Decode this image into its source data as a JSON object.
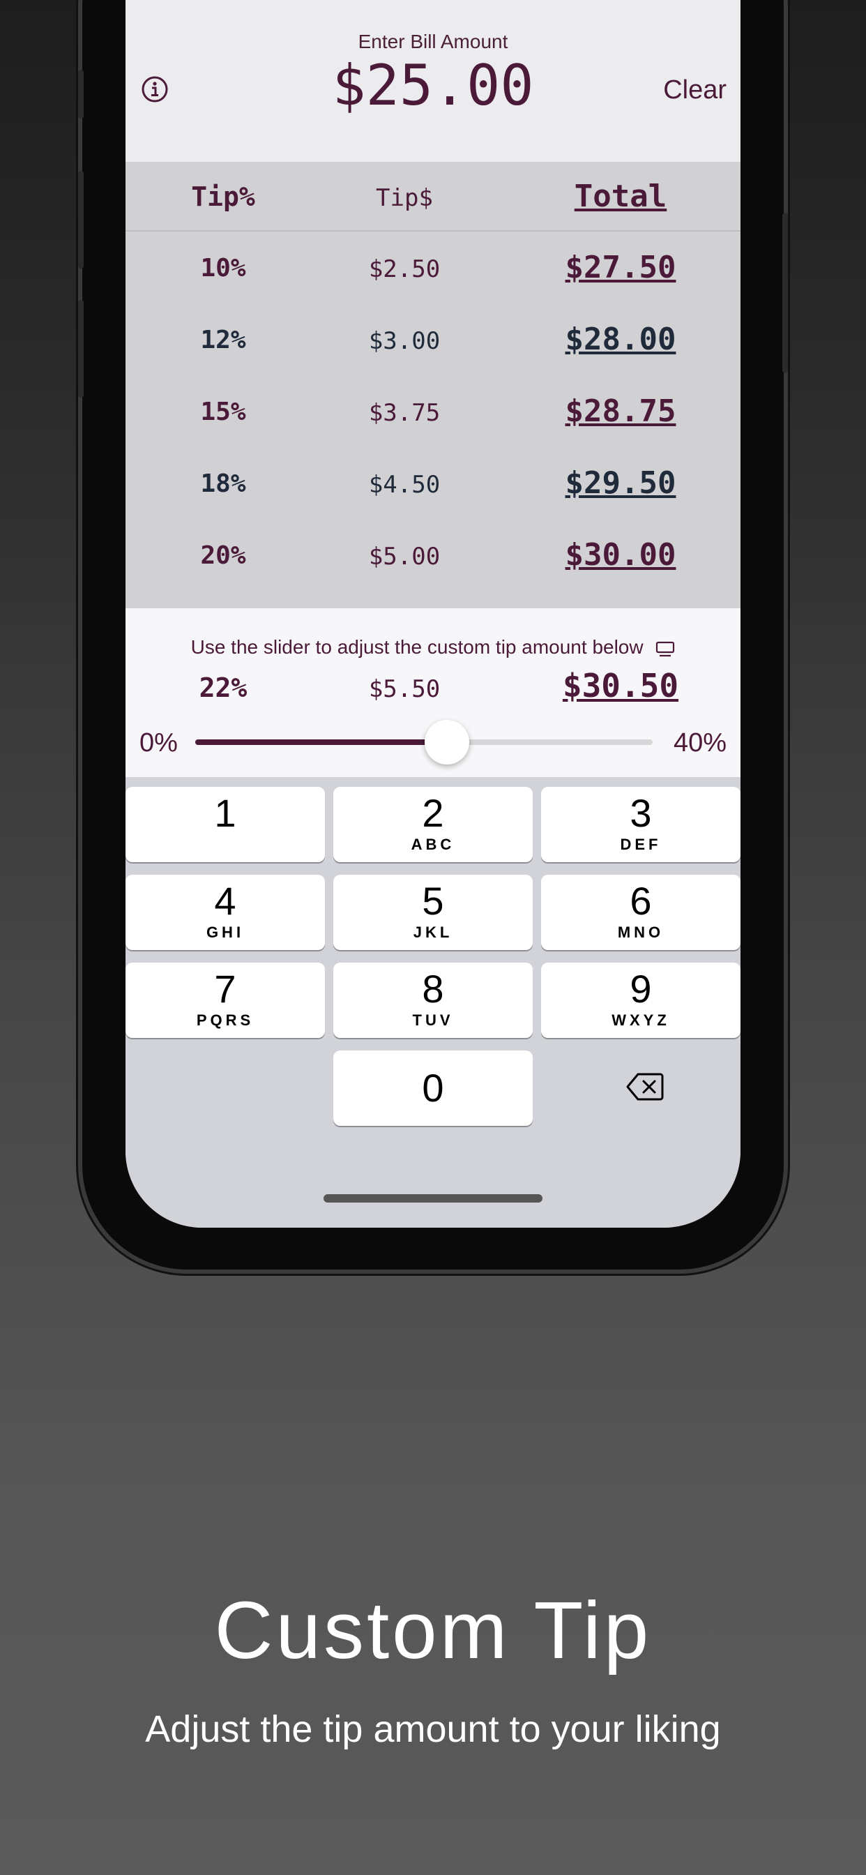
{
  "header": {
    "label": "Enter Bill Amount",
    "bill_amount": "$25.00",
    "clear_label": "Clear"
  },
  "table": {
    "headers": {
      "tip_pct": "Tip%",
      "tip_dollar": "Tip$",
      "total": "Total"
    },
    "rows": [
      {
        "pct": "10%",
        "tip": "$2.50",
        "total": "$27.50",
        "color": "#4a1a38"
      },
      {
        "pct": "12%",
        "tip": "$3.00",
        "total": "$28.00",
        "color": "#1f2a3a"
      },
      {
        "pct": "15%",
        "tip": "$3.75",
        "total": "$28.75",
        "color": "#4a1a38"
      },
      {
        "pct": "18%",
        "tip": "$4.50",
        "total": "$29.50",
        "color": "#1f2a3a"
      },
      {
        "pct": "20%",
        "tip": "$5.00",
        "total": "$30.00",
        "color": "#4a1a38"
      }
    ]
  },
  "custom": {
    "label": "Use the slider to adjust the custom tip amount below",
    "icon": "monitor-icon",
    "pct": "22%",
    "tip": "$5.50",
    "total": "$30.50",
    "slider": {
      "min_label": "0%",
      "max_label": "40%",
      "value_fraction": 0.55
    }
  },
  "keypad": {
    "keys": [
      {
        "num": "1",
        "letters": ""
      },
      {
        "num": "2",
        "letters": "ABC"
      },
      {
        "num": "3",
        "letters": "DEF"
      },
      {
        "num": "4",
        "letters": "GHI"
      },
      {
        "num": "5",
        "letters": "JKL"
      },
      {
        "num": "6",
        "letters": "MNO"
      },
      {
        "num": "7",
        "letters": "PQRS"
      },
      {
        "num": "8",
        "letters": "TUV"
      },
      {
        "num": "9",
        "letters": "WXYZ"
      },
      {
        "num": "0",
        "letters": ""
      }
    ],
    "backspace_icon": "backspace-icon"
  },
  "caption": {
    "title": "Custom Tip",
    "subtitle": "Adjust the tip amount to your liking"
  },
  "colors": {
    "accent": "#4a1a38",
    "secondary": "#1f2a3a",
    "table_bg": "#d1d1d4",
    "header_bg": "#ececee"
  }
}
